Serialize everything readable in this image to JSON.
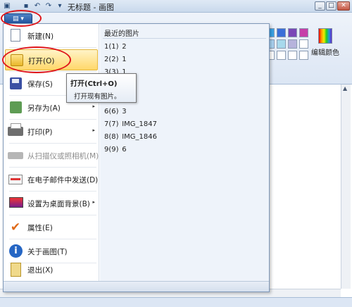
{
  "window": {
    "title": "无标题 - 画图",
    "qat_icons": [
      "paint-app-icon",
      "save-icon",
      "undo-icon",
      "redo-icon",
      "dropdown-icon"
    ],
    "controls": {
      "minimize": "_",
      "maximize": "□",
      "close": "✕"
    }
  },
  "ribbon": {
    "app_button_label": "▤ ▾",
    "edit_colors_label": "编辑颜色",
    "swatches_row1": [
      "#3aa3e6",
      "#3a6fd8",
      "#7a48b6",
      "#c63fa8"
    ],
    "swatches_row2": [
      "#a9d3f2",
      "#a7d9ec",
      "#b6b3dc",
      "#ffffff"
    ],
    "swatches_row3": [
      "#ffffff",
      "#ffffff",
      "#ffffff",
      "#ffffff"
    ]
  },
  "menu": {
    "items": [
      {
        "label": "新建(N)",
        "icon": "new-document-icon",
        "has_submenu": false,
        "disabled": false
      },
      {
        "label": "打开(O)",
        "icon": "open-folder-icon",
        "has_submenu": false,
        "disabled": false,
        "active": true
      },
      {
        "label": "保存(S)",
        "icon": "save-icon",
        "has_submenu": false,
        "disabled": false
      },
      {
        "label": "另存为(A)",
        "icon": "save-as-icon",
        "has_submenu": true,
        "disabled": false
      },
      {
        "label": "打印(P)",
        "icon": "printer-icon",
        "has_submenu": true,
        "disabled": false
      },
      {
        "label": "从扫描仪或照相机(M)",
        "icon": "scanner-icon",
        "has_submenu": false,
        "disabled": true
      },
      {
        "label": "在电子邮件中发送(D)",
        "icon": "email-icon",
        "has_submenu": false,
        "disabled": false
      },
      {
        "label": "设置为桌面背景(B)",
        "icon": "desktop-background-icon",
        "has_submenu": true,
        "disabled": false
      },
      {
        "label": "属性(E)",
        "icon": "properties-check-icon",
        "has_submenu": false,
        "disabled": false
      },
      {
        "label": "关于画图(T)",
        "icon": "info-icon",
        "has_submenu": false,
        "disabled": false
      },
      {
        "label": "退出(X)",
        "icon": "exit-icon",
        "has_submenu": false,
        "disabled": false
      }
    ],
    "submenu_arrow": "▸",
    "recent": {
      "title": "最近的图片",
      "items": [
        {
          "num": "1(1)",
          "name": "2"
        },
        {
          "num": "2(2)",
          "name": "1"
        },
        {
          "num": "3(3)",
          "name": "1"
        },
        {
          "num": "6(6)",
          "name": "3"
        },
        {
          "num": "7(7)",
          "name": "IMG_1847"
        },
        {
          "num": "8(8)",
          "name": "IMG_1846"
        },
        {
          "num": "9(9)",
          "name": "6"
        }
      ]
    }
  },
  "tooltip": {
    "title": "打开(Ctrl+O)",
    "text": "打开现有图片。"
  },
  "highlight_color": "#e0161b"
}
